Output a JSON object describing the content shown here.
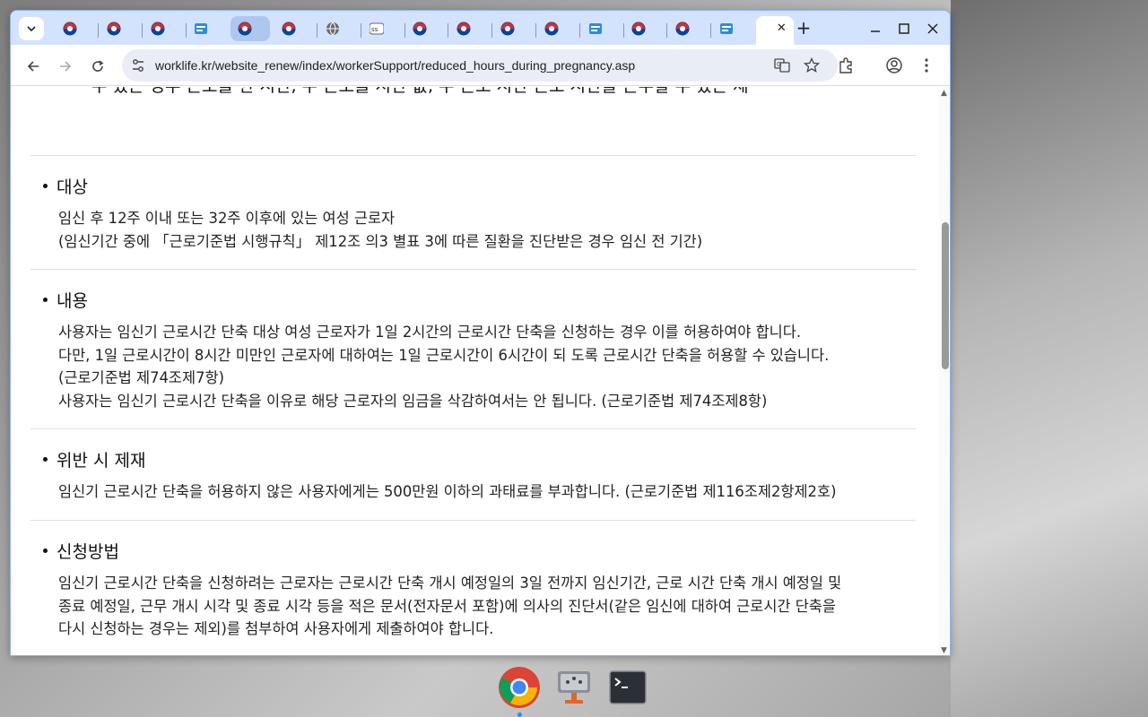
{
  "browser": {
    "url": "worklife.kr/website_renew/index/workerSupport/reduced_hours_during_pregnancy.asp",
    "tabs": [
      {
        "title": "",
        "icon": "gov-emblem-icon"
      },
      {
        "title": "",
        "icon": "gov-emblem-icon"
      },
      {
        "title": "",
        "icon": "gov-emblem-icon"
      },
      {
        "title": "",
        "icon": "document-icon"
      },
      {
        "title": "",
        "icon": "gov-emblem-icon"
      },
      {
        "title": "",
        "icon": "gov-emblem-icon"
      },
      {
        "title": "",
        "icon": "globe-icon"
      },
      {
        "title": "",
        "icon": "site-logo-icon"
      },
      {
        "title": "",
        "icon": "gov-emblem-icon"
      },
      {
        "title": "",
        "icon": "gov-emblem-icon"
      },
      {
        "title": "",
        "icon": "gov-emblem-icon"
      },
      {
        "title": "",
        "icon": "gov-emblem-icon"
      },
      {
        "title": "",
        "icon": "document-icon"
      },
      {
        "title": "",
        "icon": "gov-emblem-icon"
      },
      {
        "title": "",
        "icon": "gov-emblem-icon"
      },
      {
        "title": "",
        "icon": "document-icon"
      },
      {
        "title": "",
        "icon": "none"
      }
    ],
    "colors": {
      "tabstrip": "#d3e3fd",
      "omnibox": "#e9eef6",
      "accent": "#0b57d0"
    }
  },
  "page": {
    "cut_off_line": "수 있는 경우 근로를 한 시간, 수 근로를 시간 값, 수 근로 시간 근로 시간을 근무할 수 있는 제",
    "sections": [
      {
        "heading": "대상",
        "lines": [
          "임신 후 12주 이내 또는 32주 이후에 있는 여성 근로자",
          "(임신기간 중에 「근로기준법 시행규칙」 제12조 의3 별표 3에 따른 질환을 진단받은 경우 임신 전 기간)"
        ]
      },
      {
        "heading": "내용",
        "lines": [
          "사용자는 임신기 근로시간 단축 대상 여성 근로자가 1일 2시간의 근로시간 단축을 신청하는 경우 이를 허용하여야 합니다.",
          "다만, 1일 근로시간이 8시간 미만인 근로자에 대하여는 1일 근로시간이 6시간이 되 도록 근로시간 단축을 허용할 수 있습니다.",
          "(근로기준법 제74조제7항)",
          "사용자는 임신기 근로시간 단축을 이유로 해당 근로자의 임금을 삭감하여서는 안 됩니다. (근로기준법 제74조제8항)"
        ]
      },
      {
        "heading": "위반 시 제재",
        "lines": [
          "임신기 근로시간 단축을 허용하지 않은 사용자에게는 500만원 이하의 과태료를 부과합니다. (근로기준법 제116조제2항제2호)"
        ]
      },
      {
        "heading": "신청방법",
        "lines": [
          "임신기 근로시간 단축을 신청하려는 근로자는 근로시간 단축 개시 예정일의 3일 전까지 임신기간, 근로 시간 단축 개시 예정일 및",
          "종료 예정일, 근무 개시 시각 및 종료 시각 등을 적은 문서(전자문서 포함)에 의사의 진단서(같은 임신에 대하여 근로시간 단축을",
          "다시 신청하는 경우는 제외)를 첨부하여 사용자에게 제출하여야 합니다."
        ]
      }
    ]
  },
  "taskbar": {
    "apps": [
      {
        "name": "chrome",
        "icon": "chrome-icon"
      },
      {
        "name": "network-tool",
        "icon": "network-icon"
      },
      {
        "name": "terminal",
        "icon": "terminal-icon"
      }
    ]
  }
}
